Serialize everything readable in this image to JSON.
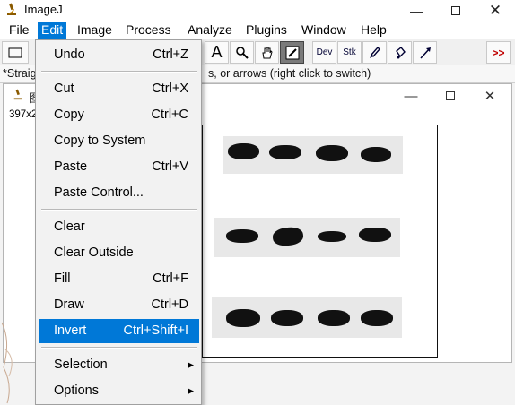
{
  "window": {
    "title": "ImageJ"
  },
  "menubar": [
    {
      "label": "File"
    },
    {
      "label": "Edit"
    },
    {
      "label": "Image"
    },
    {
      "label": "Process"
    },
    {
      "label": "Analyze"
    },
    {
      "label": "Plugins"
    },
    {
      "label": "Window"
    },
    {
      "label": "Help"
    }
  ],
  "toolbar": {
    "text_tool": "A",
    "dev_label": "Dev",
    "stk_label": "Stk",
    "more_label": ">>"
  },
  "status": {
    "prefix": "*Straig",
    "suffix": "s, or arrows (right click to switch)"
  },
  "image_window": {
    "title_partial": "图",
    "info_partial": "397x2"
  },
  "edit_menu": {
    "items": [
      {
        "label": "Undo",
        "shortcut": "Ctrl+Z"
      },
      {
        "label": "Cut",
        "shortcut": "Ctrl+X"
      },
      {
        "label": "Copy",
        "shortcut": "Ctrl+C"
      },
      {
        "label": "Copy to System",
        "shortcut": ""
      },
      {
        "label": "Paste",
        "shortcut": "Ctrl+V"
      },
      {
        "label": "Paste Control...",
        "shortcut": ""
      },
      {
        "label": "Clear",
        "shortcut": ""
      },
      {
        "label": "Clear Outside",
        "shortcut": ""
      },
      {
        "label": "Fill",
        "shortcut": "Ctrl+F"
      },
      {
        "label": "Draw",
        "shortcut": "Ctrl+D"
      },
      {
        "label": "Invert",
        "shortcut": "Ctrl+Shift+I"
      },
      {
        "label": "Selection",
        "shortcut": ""
      },
      {
        "label": "Options",
        "shortcut": ""
      }
    ],
    "highlighted": "Invert"
  },
  "colors": {
    "accent": "#0078d7",
    "band": "#111111"
  }
}
